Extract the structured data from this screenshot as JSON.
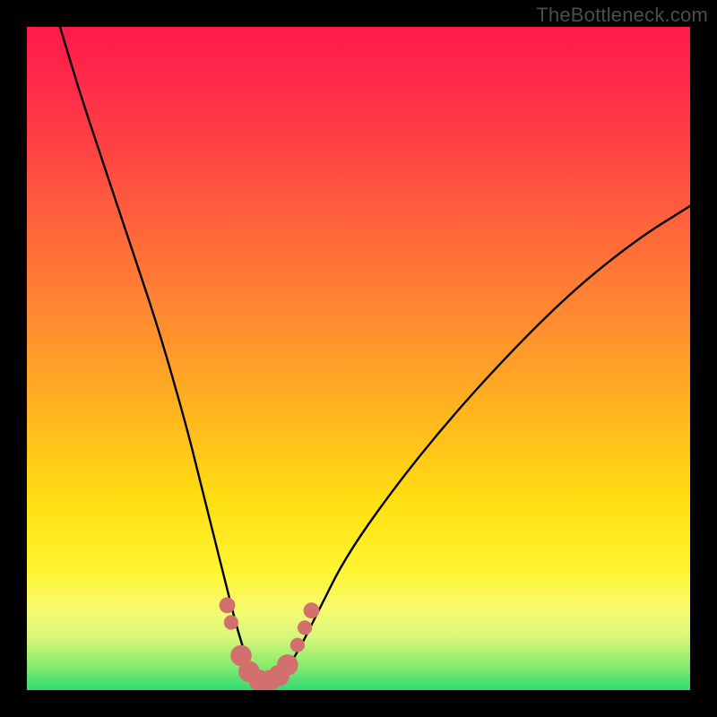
{
  "watermark": "TheBottleneck.com",
  "chart_data": {
    "type": "line",
    "title": "",
    "xlabel": "",
    "ylabel": "",
    "xlim": [
      0,
      100
    ],
    "ylim": [
      0,
      100
    ],
    "series": [
      {
        "name": "bottleneck-curve",
        "x": [
          5,
          8,
          12,
          16,
          20,
          24,
          26,
          28,
          30,
          31.5,
          33,
          34.5,
          36,
          37.5,
          39,
          41,
          44,
          48,
          55,
          63,
          72,
          82,
          92,
          100
        ],
        "y": [
          100,
          90,
          78,
          66,
          54,
          40,
          32,
          24,
          16,
          10,
          5,
          2,
          1,
          1.5,
          3,
          6,
          12,
          20,
          30,
          40,
          50,
          60,
          68,
          73
        ]
      }
    ],
    "markers": {
      "name": "highlight-dots",
      "color": "#d1706c",
      "points": [
        {
          "x": 30.2,
          "y": 12.8,
          "r": 1.2
        },
        {
          "x": 30.8,
          "y": 10.2,
          "r": 1.1
        },
        {
          "x": 32.3,
          "y": 5.2,
          "r": 1.6
        },
        {
          "x": 33.5,
          "y": 2.8,
          "r": 1.6
        },
        {
          "x": 35.0,
          "y": 1.5,
          "r": 1.6
        },
        {
          "x": 36.5,
          "y": 1.4,
          "r": 1.6
        },
        {
          "x": 38.0,
          "y": 2.2,
          "r": 1.6
        },
        {
          "x": 39.3,
          "y": 3.8,
          "r": 1.6
        },
        {
          "x": 40.8,
          "y": 6.8,
          "r": 1.1
        },
        {
          "x": 41.9,
          "y": 9.4,
          "r": 1.1
        },
        {
          "x": 42.9,
          "y": 12.0,
          "r": 1.2
        }
      ]
    },
    "gradient_stops": [
      {
        "pos": 0,
        "color": "#ff1a4a"
      },
      {
        "pos": 18,
        "color": "#ff4244"
      },
      {
        "pos": 45,
        "color": "#ff8e30"
      },
      {
        "pos": 72,
        "color": "#ffe012"
      },
      {
        "pos": 92,
        "color": "#d8f77a"
      },
      {
        "pos": 100,
        "color": "#2fdc74"
      }
    ]
  }
}
